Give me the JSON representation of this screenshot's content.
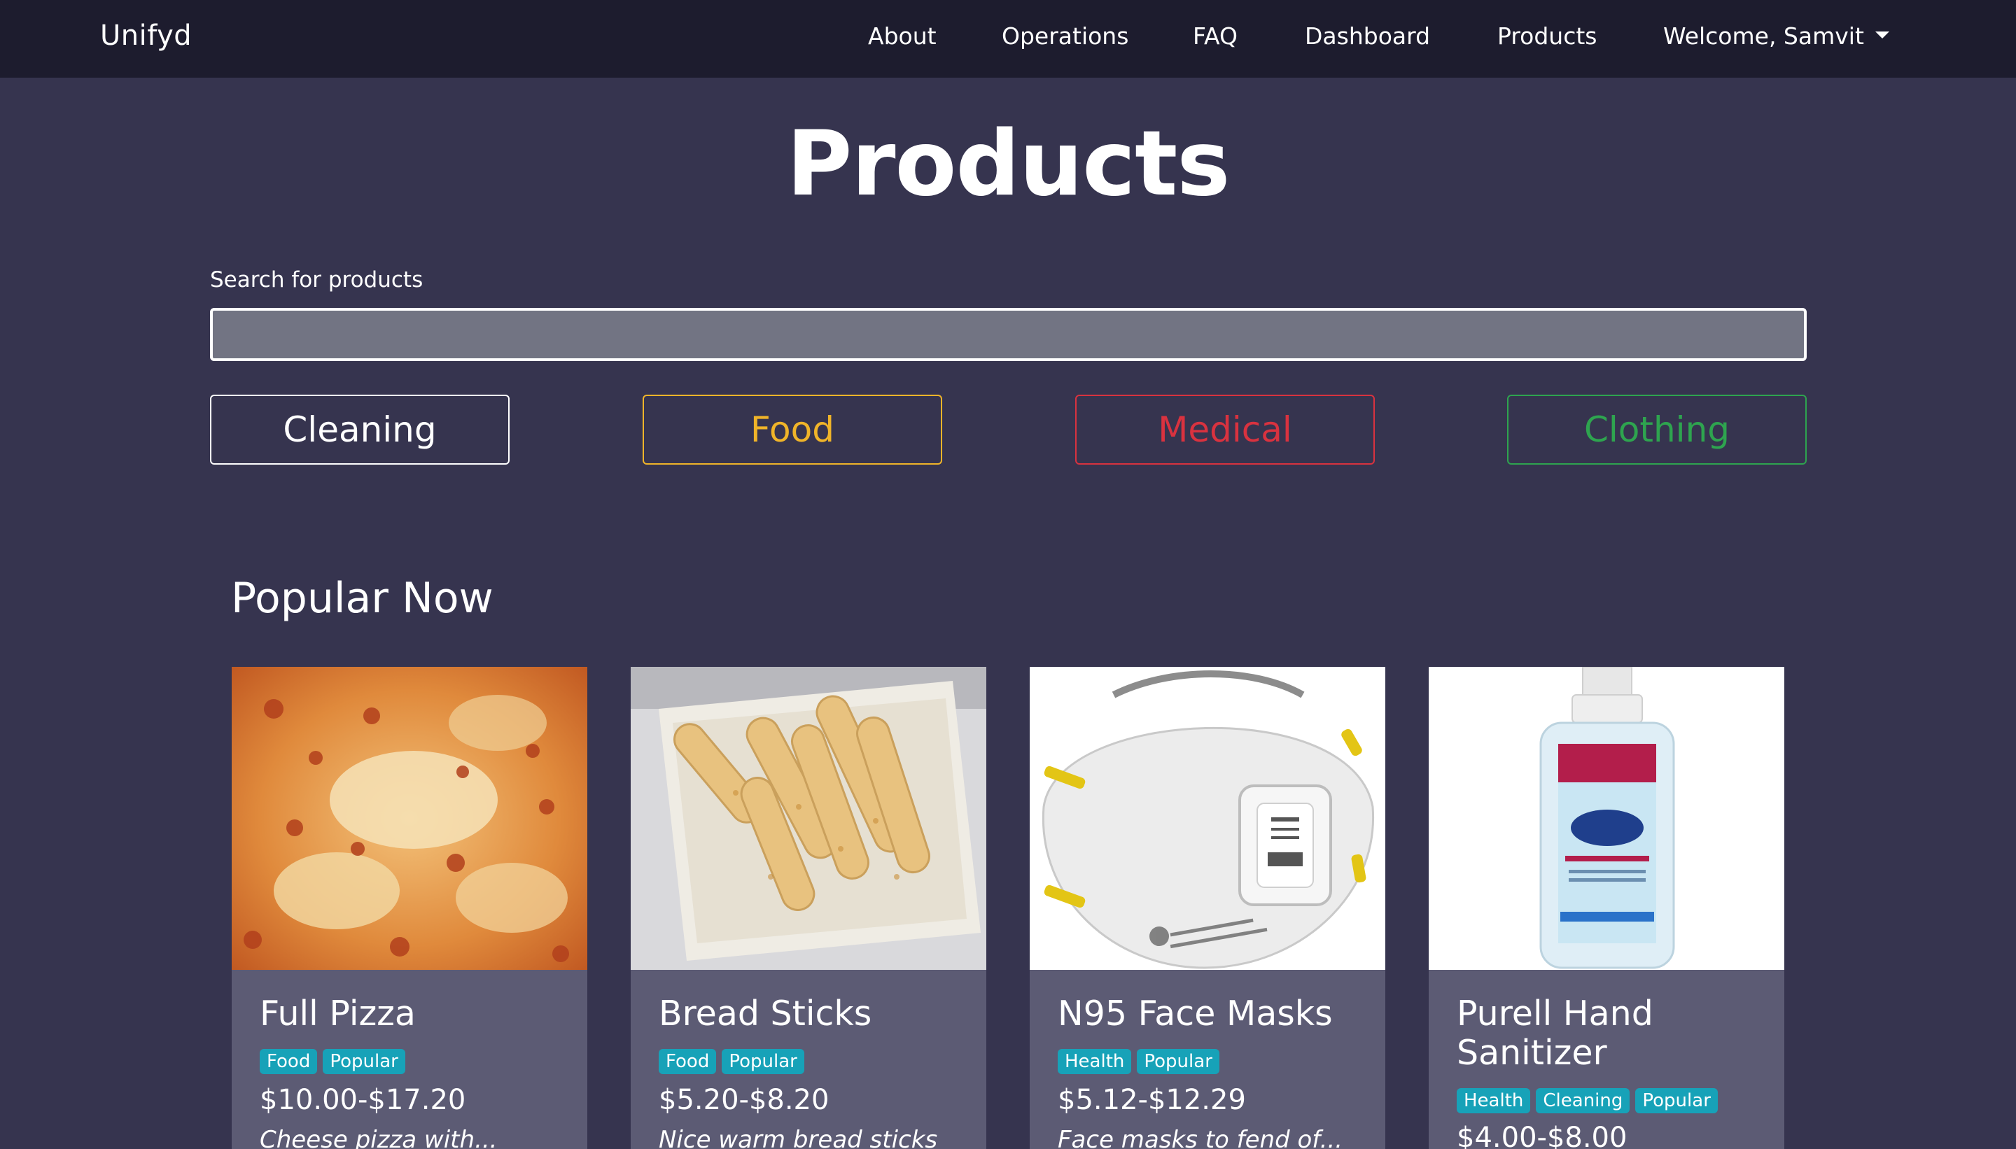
{
  "navbar": {
    "brand": "Unifyd",
    "links": [
      "About",
      "Operations",
      "FAQ",
      "Dashboard",
      "Products"
    ],
    "user_menu": "Welcome, Samvit"
  },
  "page": {
    "title": "Products",
    "search_label": "Search for products",
    "search_placeholder": "",
    "search_value": ""
  },
  "categories": [
    {
      "label": "Cleaning",
      "color": "#ffffff"
    },
    {
      "label": "Food",
      "color": "#f0b429"
    },
    {
      "label": "Medical",
      "color": "#d9323f"
    },
    {
      "label": "Clothing",
      "color": "#2ea44f"
    }
  ],
  "popular": {
    "title": "Popular Now",
    "products": [
      {
        "name": "Full Pizza",
        "tags": [
          "Food",
          "Popular"
        ],
        "price": "$10.00-$17.20",
        "description": "Cheese pizza with..."
      },
      {
        "name": "Bread Sticks",
        "tags": [
          "Food",
          "Popular"
        ],
        "price": "$5.20-$8.20",
        "description": "Nice warm bread sticks"
      },
      {
        "name": "N95 Face Masks",
        "tags": [
          "Health",
          "Popular"
        ],
        "price": "$5.12-$12.29",
        "description": "Face masks to fend of..."
      },
      {
        "name": "Purell Hand Sanitizer",
        "tags": [
          "Health",
          "Cleaning",
          "Popular"
        ],
        "price": "$4.00-$8.00",
        "description": ""
      }
    ]
  },
  "colors": {
    "background": "#36344f",
    "navbar": "#1d1c2e",
    "card": "#5c5b74",
    "badge": "#17a2b8"
  }
}
